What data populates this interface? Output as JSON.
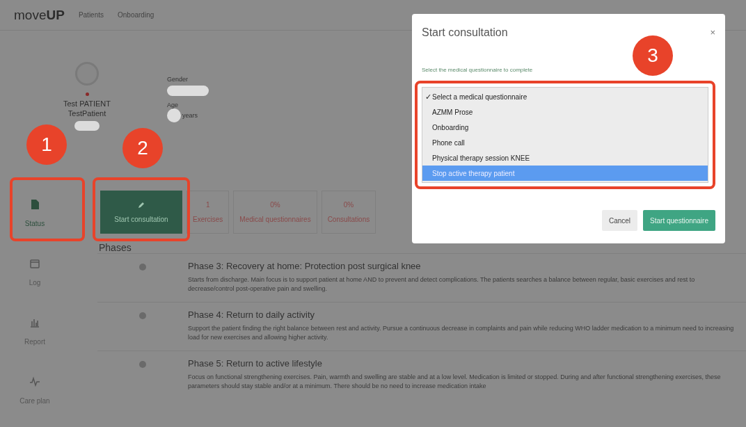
{
  "nav": {
    "logo": "move**UP**",
    "links": [
      "Patients",
      "Onboarding"
    ]
  },
  "patient": {
    "name": "Test PATIENT",
    "username": "TestPatient",
    "gender_label": "Gender",
    "age_label": "Age",
    "age_unit": "years"
  },
  "sidebar": {
    "items": [
      {
        "label": "Status",
        "selected": true
      },
      {
        "label": "Log",
        "selected": false
      },
      {
        "label": "Report",
        "selected": false
      },
      {
        "label": "Care plan",
        "selected": false
      }
    ]
  },
  "actions": {
    "start_button": "Start consultation",
    "stats": [
      {
        "value": "1",
        "label": "Exercises"
      },
      {
        "value": "0%",
        "label": "Medical questionnaires"
      },
      {
        "value": "0%",
        "label": "Consultations"
      }
    ]
  },
  "phases": {
    "title": "Phases",
    "items": [
      {
        "title": "Phase 3: Recovery at home: Protection post surgical knee",
        "description": "Starts from discharge. Main focus is to support patient at home AND to prevent and detect complications. The patients searches a balance between regular, basic exercises and rest to decrease/control post-operative pain and swelling."
      },
      {
        "title": "Phase 4: Return to daily activity",
        "description": "Support the patient finding the right balance between rest and activity. Pursue a continuous decrease in complaints and pain while reducing WHO ladder medication to a minimum need to increasing load for new exercises and allowing higher activity."
      },
      {
        "title": "Phase 5: Return to active lifestyle",
        "description": "Focus on functional strengthening exercises. Pain, warmth and swelling are stable and at a low level. Medication is limited or stopped. During and after functional strengthening exercises, these parameters should stay stable and/or at a minimum. There should be no need to increase medication intake"
      }
    ]
  },
  "dialog": {
    "title": "Start consultation",
    "close": "×",
    "prompt": "Select the medical questionnaire to complete",
    "options": [
      {
        "label": "Select a medical questionnaire",
        "checked": true,
        "selected": false
      },
      {
        "label": "AZMM Prose",
        "checked": false,
        "selected": false
      },
      {
        "label": "Onboarding",
        "checked": false,
        "selected": false
      },
      {
        "label": "Phone call",
        "checked": false,
        "selected": false
      },
      {
        "label": "Physical therapy session KNEE",
        "checked": false,
        "selected": false
      },
      {
        "label": "Stop active therapy patient",
        "checked": false,
        "selected": true
      }
    ],
    "check_mark": "✓",
    "buttons": [
      {
        "label": "Cancel",
        "kind": "secondary"
      },
      {
        "label": "Start questionnaire",
        "kind": "primary"
      }
    ]
  },
  "callouts": [
    "1",
    "2",
    "3"
  ]
}
